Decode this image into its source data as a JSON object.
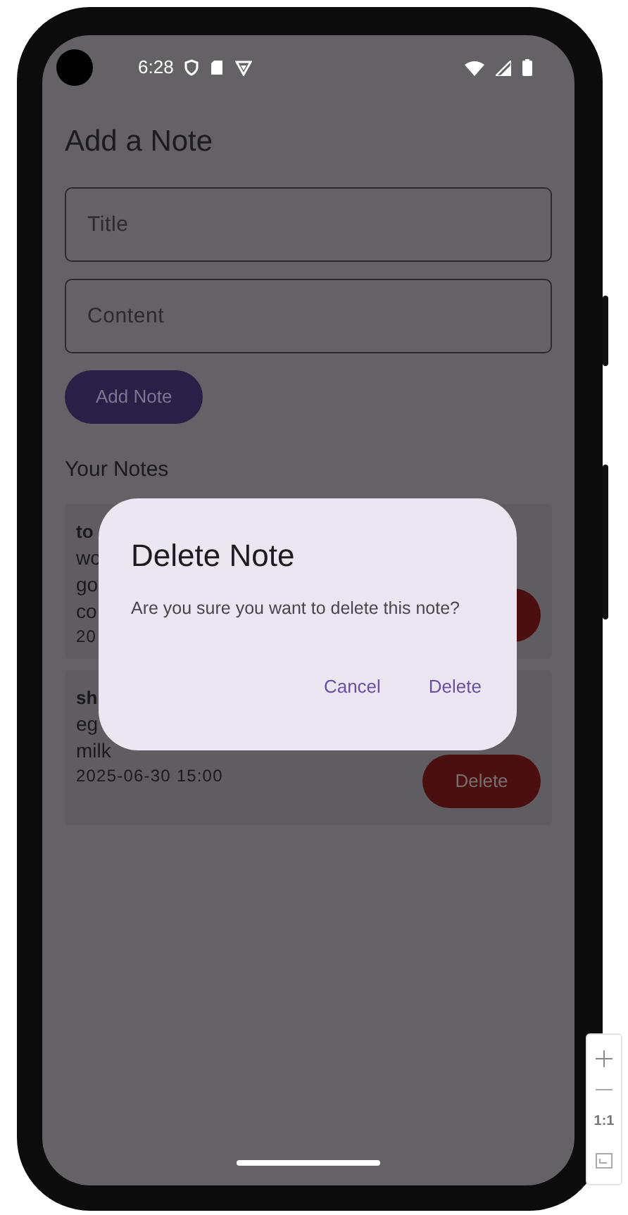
{
  "status_bar": {
    "time": "6:28"
  },
  "heading": "Add a Note",
  "fields": [
    {
      "placeholder": "Title"
    },
    {
      "placeholder": "Content"
    }
  ],
  "add_button": "Add Note",
  "notes_heading": "Your Notes",
  "notes": [
    {
      "title": "to",
      "lines": [
        "wo",
        "go",
        "co"
      ],
      "date": "20"
    },
    {
      "title": "sh",
      "lines": [
        "eg",
        "milk"
      ],
      "date": "2025-06-30 15:00",
      "delete_label": "Delete"
    }
  ],
  "dialog": {
    "title": "Delete Note",
    "message": "Are you sure you want to delete this note?",
    "buttons": [
      "Cancel",
      "Delete"
    ]
  },
  "zoom_controls": {
    "reset_label": "1:1"
  }
}
